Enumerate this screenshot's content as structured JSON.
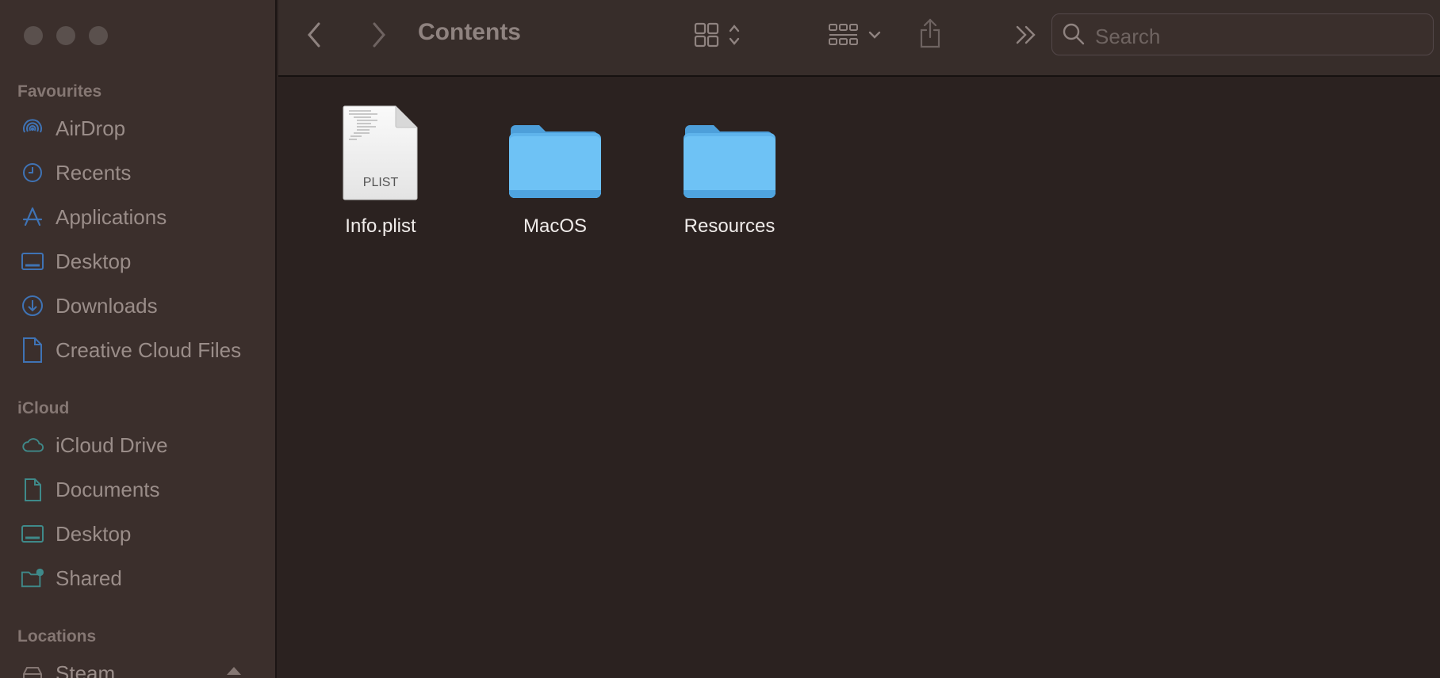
{
  "window": {
    "title": "Contents",
    "search_placeholder": "Search"
  },
  "sidebar": {
    "favourites_label": "Favourites",
    "favourites": [
      {
        "label": "AirDrop",
        "icon": "airdrop-icon"
      },
      {
        "label": "Recents",
        "icon": "clock-icon"
      },
      {
        "label": "Applications",
        "icon": "applications-icon"
      },
      {
        "label": "Desktop",
        "icon": "desktop-icon"
      },
      {
        "label": "Downloads",
        "icon": "download-icon"
      },
      {
        "label": "Creative Cloud Files",
        "icon": "document-icon"
      }
    ],
    "icloud_label": "iCloud",
    "icloud": [
      {
        "label": "iCloud Drive",
        "icon": "cloud-icon"
      },
      {
        "label": "Documents",
        "icon": "document-icon"
      },
      {
        "label": "Desktop",
        "icon": "desktop-icon"
      },
      {
        "label": "Shared",
        "icon": "shared-folder-icon"
      }
    ],
    "locations_label": "Locations",
    "locations": [
      {
        "label": "Steam",
        "icon": "drive-icon"
      }
    ]
  },
  "files": [
    {
      "name": "Info.plist",
      "kind": "plist",
      "badge": "PLIST"
    },
    {
      "name": "MacOS",
      "kind": "folder"
    },
    {
      "name": "Resources",
      "kind": "folder"
    }
  ],
  "colors": {
    "folder": "#6ec2f5",
    "sidebar_icon_blue": "#3f73b5",
    "sidebar_icon_teal": "#3f8a8a"
  }
}
